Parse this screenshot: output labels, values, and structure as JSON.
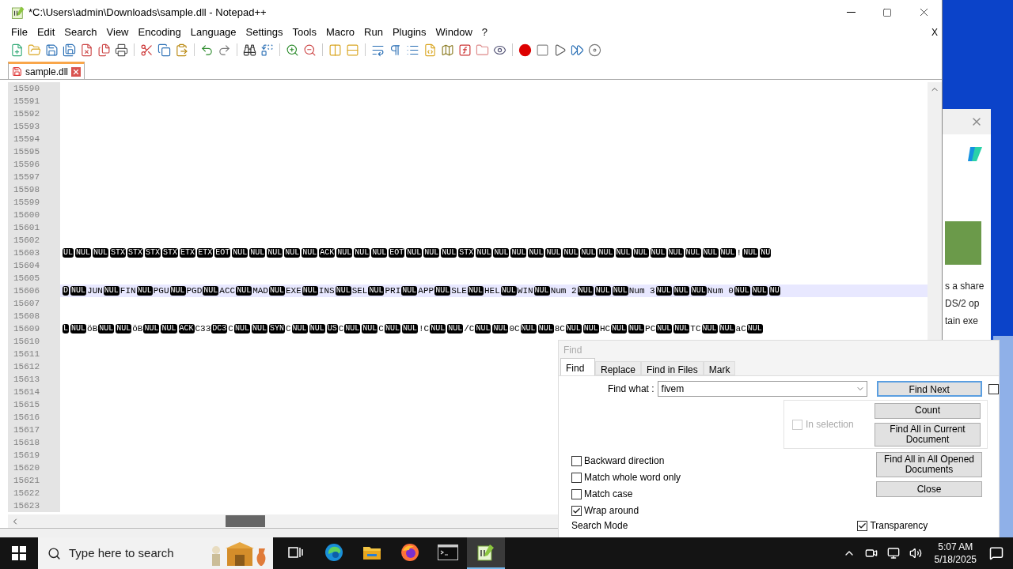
{
  "window": {
    "title": "*C:\\Users\\admin\\Downloads\\sample.dll - Notepad++",
    "close_document": "X"
  },
  "menu": [
    "File",
    "Edit",
    "Search",
    "View",
    "Encoding",
    "Language",
    "Settings",
    "Tools",
    "Macro",
    "Run",
    "Plugins",
    "Window",
    "?"
  ],
  "tabs": [
    {
      "label": "sample.dll",
      "selected": true
    }
  ],
  "editor": {
    "lines": [
      {
        "number": "15590",
        "current": false
      },
      {
        "number": "15591",
        "current": false
      },
      {
        "number": "15592",
        "current": false
      },
      {
        "number": "15593",
        "current": false
      },
      {
        "number": "15594",
        "current": false
      },
      {
        "number": "15595",
        "current": false
      },
      {
        "number": "15596",
        "current": false
      },
      {
        "number": "15597",
        "current": false
      },
      {
        "number": "15598",
        "current": false
      },
      {
        "number": "15599",
        "current": false
      },
      {
        "number": "15600",
        "current": false
      },
      {
        "number": "15601",
        "current": false
      },
      {
        "number": "15602",
        "current": false
      },
      {
        "number": "15603",
        "current": false,
        "segments": [
          {
            "kind": "ctrl",
            "text": "UL"
          },
          {
            "kind": "ctrl",
            "text": "NUL"
          },
          {
            "kind": "ctrl",
            "text": "NUL"
          },
          {
            "kind": "ctrl",
            "text": "STX"
          },
          {
            "kind": "ctrl",
            "text": "STX"
          },
          {
            "kind": "ctrl",
            "text": "STX"
          },
          {
            "kind": "ctrl",
            "text": "STX"
          },
          {
            "kind": "ctrl",
            "text": "ETX"
          },
          {
            "kind": "ctrl",
            "text": "ETX"
          },
          {
            "kind": "ctrl",
            "text": "EOT"
          },
          {
            "kind": "ctrl",
            "text": "NUL"
          },
          {
            "kind": "ctrl",
            "text": "NUL"
          },
          {
            "kind": "ctrl",
            "text": "NUL"
          },
          {
            "kind": "ctrl",
            "text": "NUL"
          },
          {
            "kind": "ctrl",
            "text": "NUL"
          },
          {
            "kind": "ctrl",
            "text": "ACK"
          },
          {
            "kind": "ctrl",
            "text": "NUL"
          },
          {
            "kind": "ctrl",
            "text": "NUL"
          },
          {
            "kind": "ctrl",
            "text": "NUL"
          },
          {
            "kind": "ctrl",
            "text": "EOT"
          },
          {
            "kind": "ctrl",
            "text": "NUL"
          },
          {
            "kind": "ctrl",
            "text": "NUL"
          },
          {
            "kind": "ctrl",
            "text": "NUL"
          },
          {
            "kind": "ctrl",
            "text": "STX"
          },
          {
            "kind": "ctrl",
            "text": "NUL"
          },
          {
            "kind": "ctrl",
            "text": "NUL"
          },
          {
            "kind": "ctrl",
            "text": "NUL"
          },
          {
            "kind": "ctrl",
            "text": "NUL"
          },
          {
            "kind": "ctrl",
            "text": "NUL"
          },
          {
            "kind": "ctrl",
            "text": "NUL"
          },
          {
            "kind": "ctrl",
            "text": "NUL"
          },
          {
            "kind": "ctrl",
            "text": "NUL"
          },
          {
            "kind": "ctrl",
            "text": "NUL"
          },
          {
            "kind": "ctrl",
            "text": "NUL"
          },
          {
            "kind": "ctrl",
            "text": "NUL"
          },
          {
            "kind": "ctrl",
            "text": "NUL"
          },
          {
            "kind": "ctrl",
            "text": "NUL"
          },
          {
            "kind": "ctrl",
            "text": "NUL"
          },
          {
            "kind": "ctrl",
            "text": "NUL"
          },
          {
            "kind": "text",
            "text": "!"
          },
          {
            "kind": "ctrl",
            "text": "NUL"
          },
          {
            "kind": "ctrl",
            "text": "NU"
          }
        ]
      },
      {
        "number": "15604",
        "current": false
      },
      {
        "number": "15605",
        "current": false
      },
      {
        "number": "15606",
        "current": true,
        "segments": [
          {
            "kind": "ctrl",
            "text": "D"
          },
          {
            "kind": "ctrl",
            "text": "NUL"
          },
          {
            "kind": "text",
            "text": "JUN"
          },
          {
            "kind": "ctrl",
            "text": "NUL"
          },
          {
            "kind": "text",
            "text": "FIN"
          },
          {
            "kind": "ctrl",
            "text": "NUL"
          },
          {
            "kind": "text",
            "text": "PGU"
          },
          {
            "kind": "ctrl",
            "text": "NUL"
          },
          {
            "kind": "text",
            "text": "PGD"
          },
          {
            "kind": "ctrl",
            "text": "NUL"
          },
          {
            "kind": "text",
            "text": "ACC"
          },
          {
            "kind": "ctrl",
            "text": "NUL"
          },
          {
            "kind": "text",
            "text": "MAD"
          },
          {
            "kind": "ctrl",
            "text": "NUL"
          },
          {
            "kind": "text",
            "text": "EXE"
          },
          {
            "kind": "ctrl",
            "text": "NUL"
          },
          {
            "kind": "text",
            "text": "INS"
          },
          {
            "kind": "ctrl",
            "text": "NUL"
          },
          {
            "kind": "text",
            "text": "SEL"
          },
          {
            "kind": "ctrl",
            "text": "NUL"
          },
          {
            "kind": "text",
            "text": "PRI"
          },
          {
            "kind": "ctrl",
            "text": "NUL"
          },
          {
            "kind": "text",
            "text": "APP"
          },
          {
            "kind": "ctrl",
            "text": "NUL"
          },
          {
            "kind": "text",
            "text": "SLE"
          },
          {
            "kind": "ctrl",
            "text": "NUL"
          },
          {
            "kind": "text",
            "text": "HEL"
          },
          {
            "kind": "ctrl",
            "text": "NUL"
          },
          {
            "kind": "text",
            "text": "WIN"
          },
          {
            "kind": "ctrl",
            "text": "NUL"
          },
          {
            "kind": "text",
            "text": "Num 2"
          },
          {
            "kind": "ctrl",
            "text": "NUL"
          },
          {
            "kind": "ctrl",
            "text": "NUL"
          },
          {
            "kind": "ctrl",
            "text": "NUL"
          },
          {
            "kind": "text",
            "text": "Num 3"
          },
          {
            "kind": "ctrl",
            "text": "NUL"
          },
          {
            "kind": "ctrl",
            "text": "NUL"
          },
          {
            "kind": "ctrl",
            "text": "NUL"
          },
          {
            "kind": "text",
            "text": "Num 0"
          },
          {
            "kind": "ctrl",
            "text": "NUL"
          },
          {
            "kind": "ctrl",
            "text": "NUL"
          },
          {
            "kind": "ctrl",
            "text": "NU"
          }
        ]
      },
      {
        "number": "15607",
        "current": false
      },
      {
        "number": "15608",
        "current": false
      },
      {
        "number": "15609",
        "current": false,
        "segments": [
          {
            "kind": "ctrl",
            "text": "L"
          },
          {
            "kind": "ctrl",
            "text": "NUL"
          },
          {
            "kind": "text",
            "text": "öB"
          },
          {
            "kind": "ctrl",
            "text": "NUL"
          },
          {
            "kind": "ctrl",
            "text": "NUL"
          },
          {
            "kind": "text",
            "text": "öB"
          },
          {
            "kind": "ctrl",
            "text": "NUL"
          },
          {
            "kind": "ctrl",
            "text": "NUL"
          },
          {
            "kind": "ctrl",
            "text": "ACK"
          },
          {
            "kind": "text",
            "text": "C33"
          },
          {
            "kind": "ctrl",
            "text": "DC3"
          },
          {
            "kind": "text",
            "text": "C"
          },
          {
            "kind": "ctrl",
            "text": "NUL"
          },
          {
            "kind": "ctrl",
            "text": "NUL"
          },
          {
            "kind": "ctrl",
            "text": "SYN"
          },
          {
            "kind": "text",
            "text": "C"
          },
          {
            "kind": "ctrl",
            "text": "NUL"
          },
          {
            "kind": "ctrl",
            "text": "NUL"
          },
          {
            "kind": "ctrl",
            "text": "US"
          },
          {
            "kind": "text",
            "text": "C"
          },
          {
            "kind": "ctrl",
            "text": "NUL"
          },
          {
            "kind": "ctrl",
            "text": "NUL"
          },
          {
            "kind": "text",
            "text": "C"
          },
          {
            "kind": "ctrl",
            "text": "NUL"
          },
          {
            "kind": "ctrl",
            "text": "NUL"
          },
          {
            "kind": "text",
            "text": "!C"
          },
          {
            "kind": "ctrl",
            "text": "NUL"
          },
          {
            "kind": "ctrl",
            "text": "NUL"
          },
          {
            "kind": "text",
            "text": "/C"
          },
          {
            "kind": "ctrl",
            "text": "NUL"
          },
          {
            "kind": "ctrl",
            "text": "NUL"
          },
          {
            "kind": "text",
            "text": "0C"
          },
          {
            "kind": "ctrl",
            "text": "NUL"
          },
          {
            "kind": "ctrl",
            "text": "NUL"
          },
          {
            "kind": "text",
            "text": "8C"
          },
          {
            "kind": "ctrl",
            "text": "NUL"
          },
          {
            "kind": "ctrl",
            "text": "NUL"
          },
          {
            "kind": "text",
            "text": "HC"
          },
          {
            "kind": "ctrl",
            "text": "NUL"
          },
          {
            "kind": "ctrl",
            "text": "NUL"
          },
          {
            "kind": "text",
            "text": "PC"
          },
          {
            "kind": "ctrl",
            "text": "NUL"
          },
          {
            "kind": "ctrl",
            "text": "NUL"
          },
          {
            "kind": "text",
            "text": "TC"
          },
          {
            "kind": "ctrl",
            "text": "NUL"
          },
          {
            "kind": "ctrl",
            "text": "NUL"
          },
          {
            "kind": "text",
            "text": "aC"
          },
          {
            "kind": "ctrl",
            "text": "NUL"
          }
        ]
      },
      {
        "number": "15610",
        "current": false
      },
      {
        "number": "15611",
        "current": false
      },
      {
        "number": "15612",
        "current": false
      },
      {
        "number": "15613",
        "current": false
      },
      {
        "number": "15614",
        "current": false
      },
      {
        "number": "15615",
        "current": false
      },
      {
        "number": "15616",
        "current": false
      },
      {
        "number": "15617",
        "current": false
      },
      {
        "number": "15618",
        "current": false
      },
      {
        "number": "15619",
        "current": false
      },
      {
        "number": "15620",
        "current": false
      },
      {
        "number": "15621",
        "current": false
      },
      {
        "number": "15622",
        "current": false
      },
      {
        "number": "15623",
        "current": false
      }
    ]
  },
  "find_dialog": {
    "title": "Find",
    "tabs": [
      {
        "label": "Find",
        "selected": true
      },
      {
        "label": "Replace",
        "selected": false
      },
      {
        "label": "Find in Files",
        "selected": false
      },
      {
        "label": "Mark",
        "selected": false
      }
    ],
    "find_what_label": "Find what :",
    "find_what_value": "fivem",
    "find_next": {
      "label": "Find Next",
      "default": true
    },
    "side_checkbox": {
      "checked": false
    },
    "in_selection": {
      "label": "In selection",
      "checked": false,
      "disabled": true
    },
    "group_buttons": [
      {
        "label": "Count"
      },
      {
        "label": "Find All in Current Document"
      }
    ],
    "other_buttons": [
      {
        "label": "Find All in All Opened Documents"
      },
      {
        "label": "Close"
      }
    ],
    "options": [
      {
        "label": "Backward direction",
        "checked": false
      },
      {
        "label": "Match whole word only",
        "checked": false
      },
      {
        "label": "Match case",
        "checked": false
      },
      {
        "label": "Wrap around",
        "checked": true
      }
    ],
    "search_mode_label": "Search Mode",
    "transparency": {
      "label": "Transparency",
      "checked": true
    }
  },
  "background_window": {
    "texts": [
      "s a share",
      "DS/2 op",
      "tain exe"
    ]
  },
  "taskbar": {
    "search_placeholder": "Type here to search",
    "apps": [
      {
        "kind": "task-view",
        "selected": false
      },
      {
        "kind": "edge",
        "selected": false
      },
      {
        "kind": "explorer",
        "selected": false
      },
      {
        "kind": "firefox",
        "selected": false
      },
      {
        "kind": "terminal",
        "selected": false
      },
      {
        "kind": "notepad",
        "selected": true
      }
    ],
    "time": "5:07 AM",
    "date": "5/18/2025"
  }
}
